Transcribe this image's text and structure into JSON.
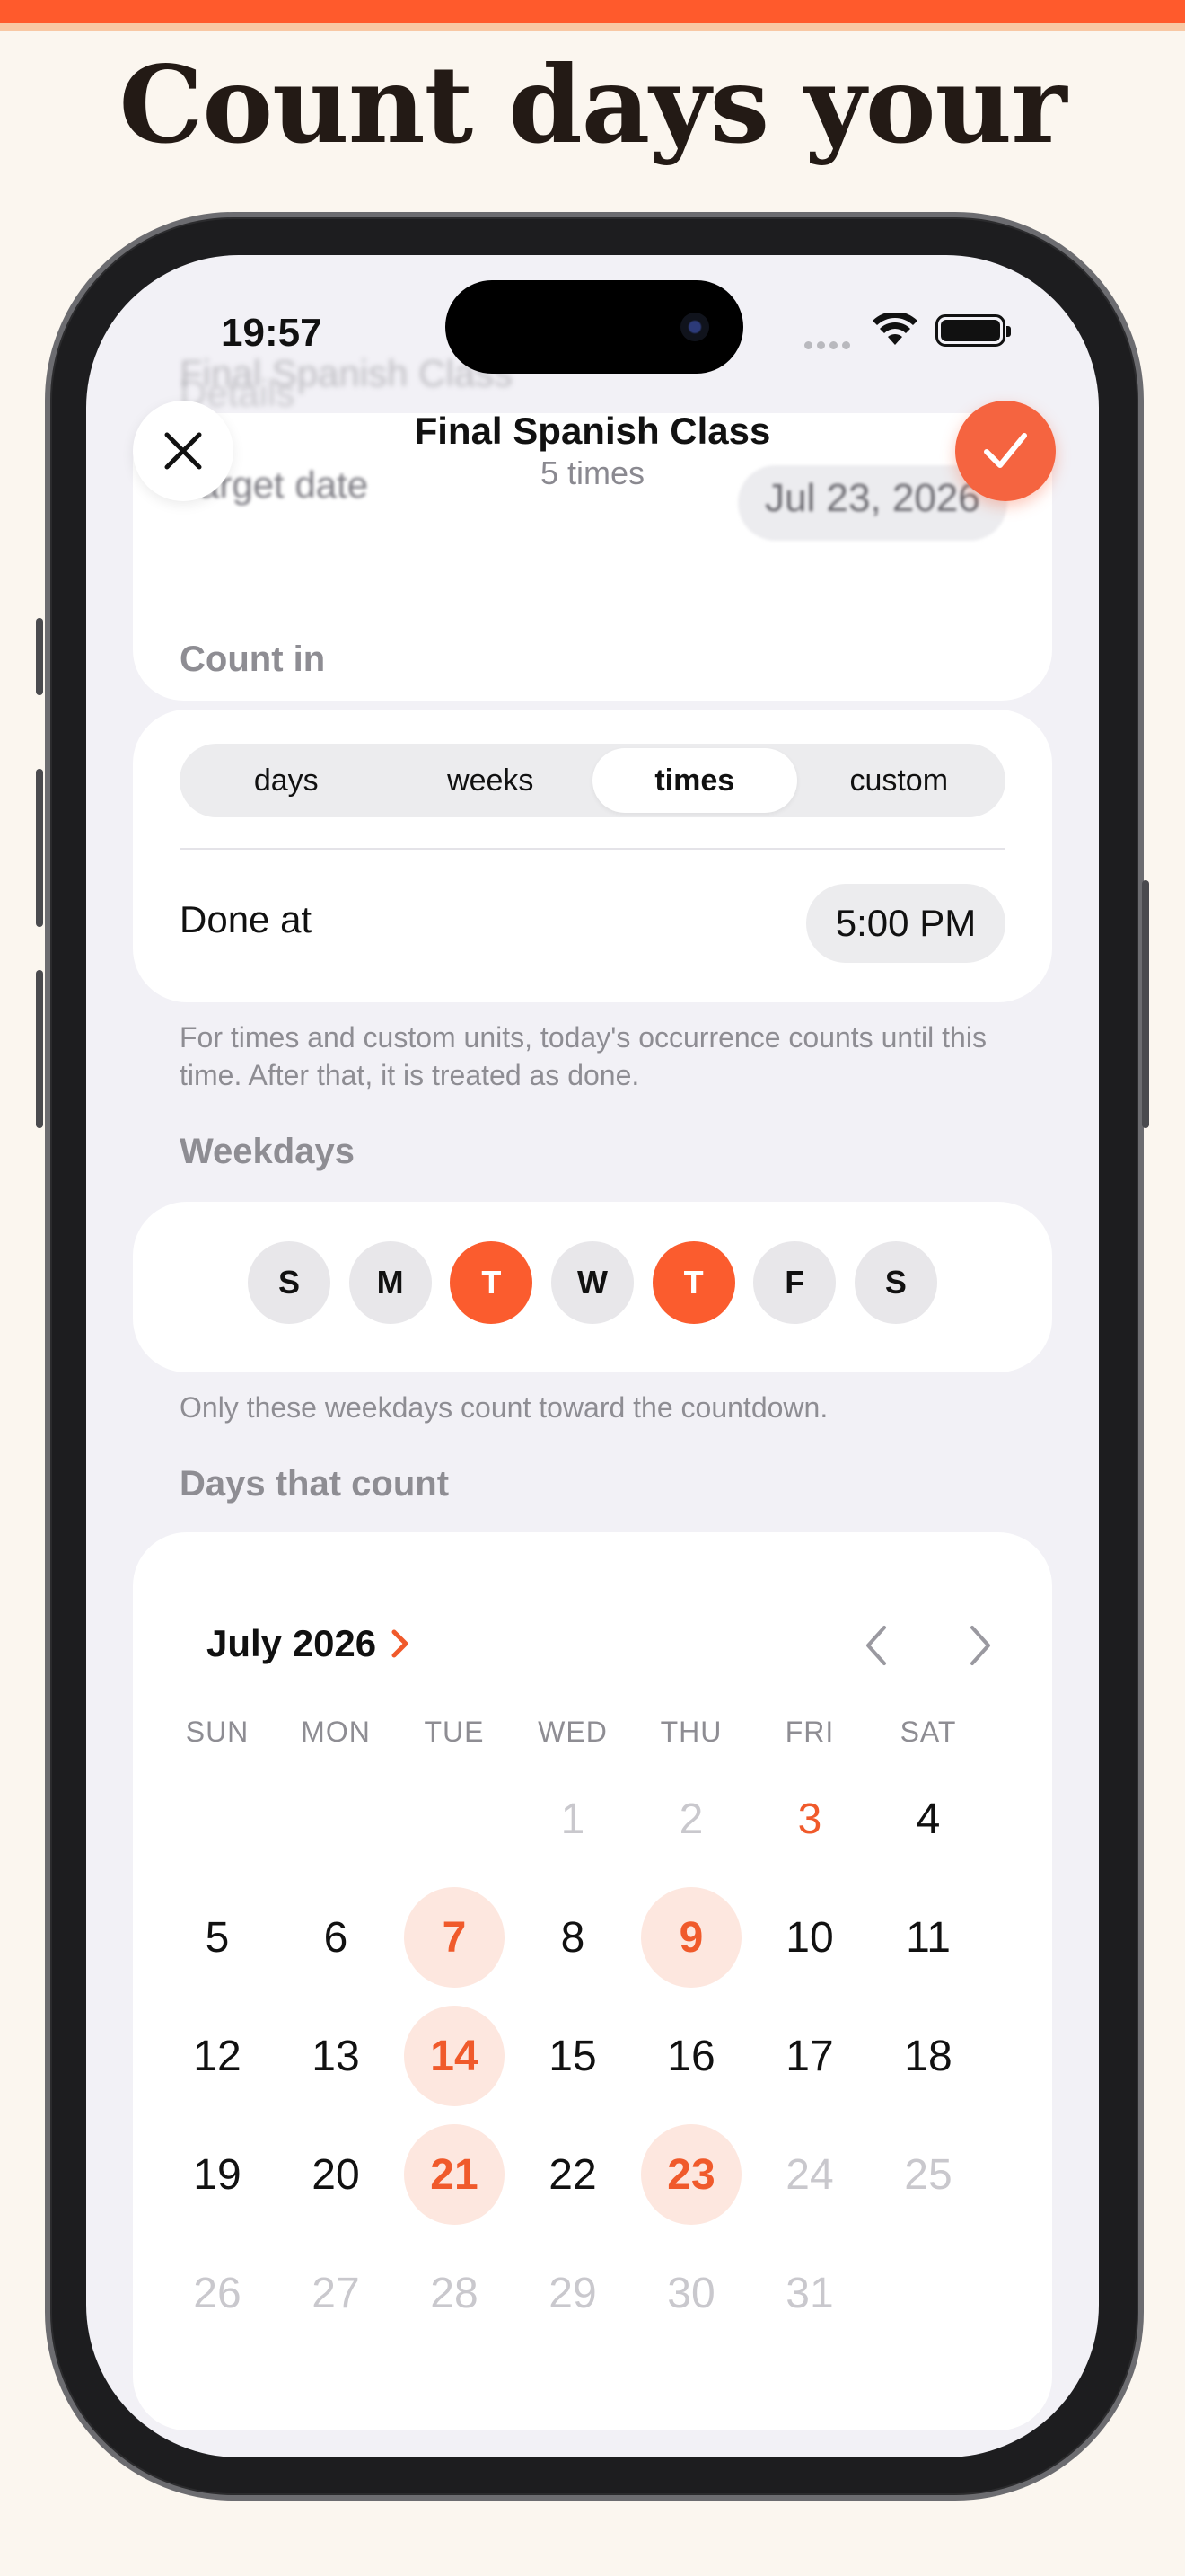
{
  "headline": "Count days your way",
  "status": {
    "time": "19:57"
  },
  "ghost": {
    "details_label": "Details",
    "title_value": "Final Spanish Class",
    "target_label": "Target date",
    "target_value": "Jul 23, 2026"
  },
  "nav": {
    "title": "Final Spanish Class",
    "subtitle": "5 times"
  },
  "count_in": {
    "section_label": "Count in",
    "segments": [
      "days",
      "weeks",
      "times",
      "custom"
    ],
    "selected": "times",
    "done_label": "Done at",
    "done_time": "5:00 PM",
    "footnote": "For times and custom units, today's occurrence counts until this time. After that, it is treated as done."
  },
  "weekdays": {
    "section_label": "Weekdays",
    "days": [
      "S",
      "M",
      "T",
      "W",
      "T",
      "F",
      "S"
    ],
    "selected_indices": [
      2,
      4
    ],
    "footnote": "Only these weekdays count toward the countdown."
  },
  "calendar": {
    "section_label": "Days that count",
    "month": "July 2026",
    "headers": [
      "SUN",
      "MON",
      "TUE",
      "WED",
      "THU",
      "FRI",
      "SAT"
    ],
    "weeks": [
      [
        "",
        "",
        "",
        "1",
        "2",
        "3",
        "4"
      ],
      [
        "5",
        "6",
        "7",
        "8",
        "9",
        "10",
        "11"
      ],
      [
        "12",
        "13",
        "14",
        "15",
        "16",
        "17",
        "18"
      ],
      [
        "19",
        "20",
        "21",
        "22",
        "23",
        "24",
        "25"
      ],
      [
        "26",
        "27",
        "28",
        "29",
        "30",
        "31",
        ""
      ]
    ],
    "selected_days": [
      "7",
      "9",
      "14",
      "21",
      "23"
    ],
    "today": "3",
    "muted_days": [
      "1",
      "2",
      "24",
      "25",
      "26",
      "27",
      "28",
      "29",
      "30",
      "31"
    ]
  },
  "colors": {
    "accent": "#F56440",
    "background": "#FBF6EF",
    "selected_fill": "#FDE7DF"
  }
}
